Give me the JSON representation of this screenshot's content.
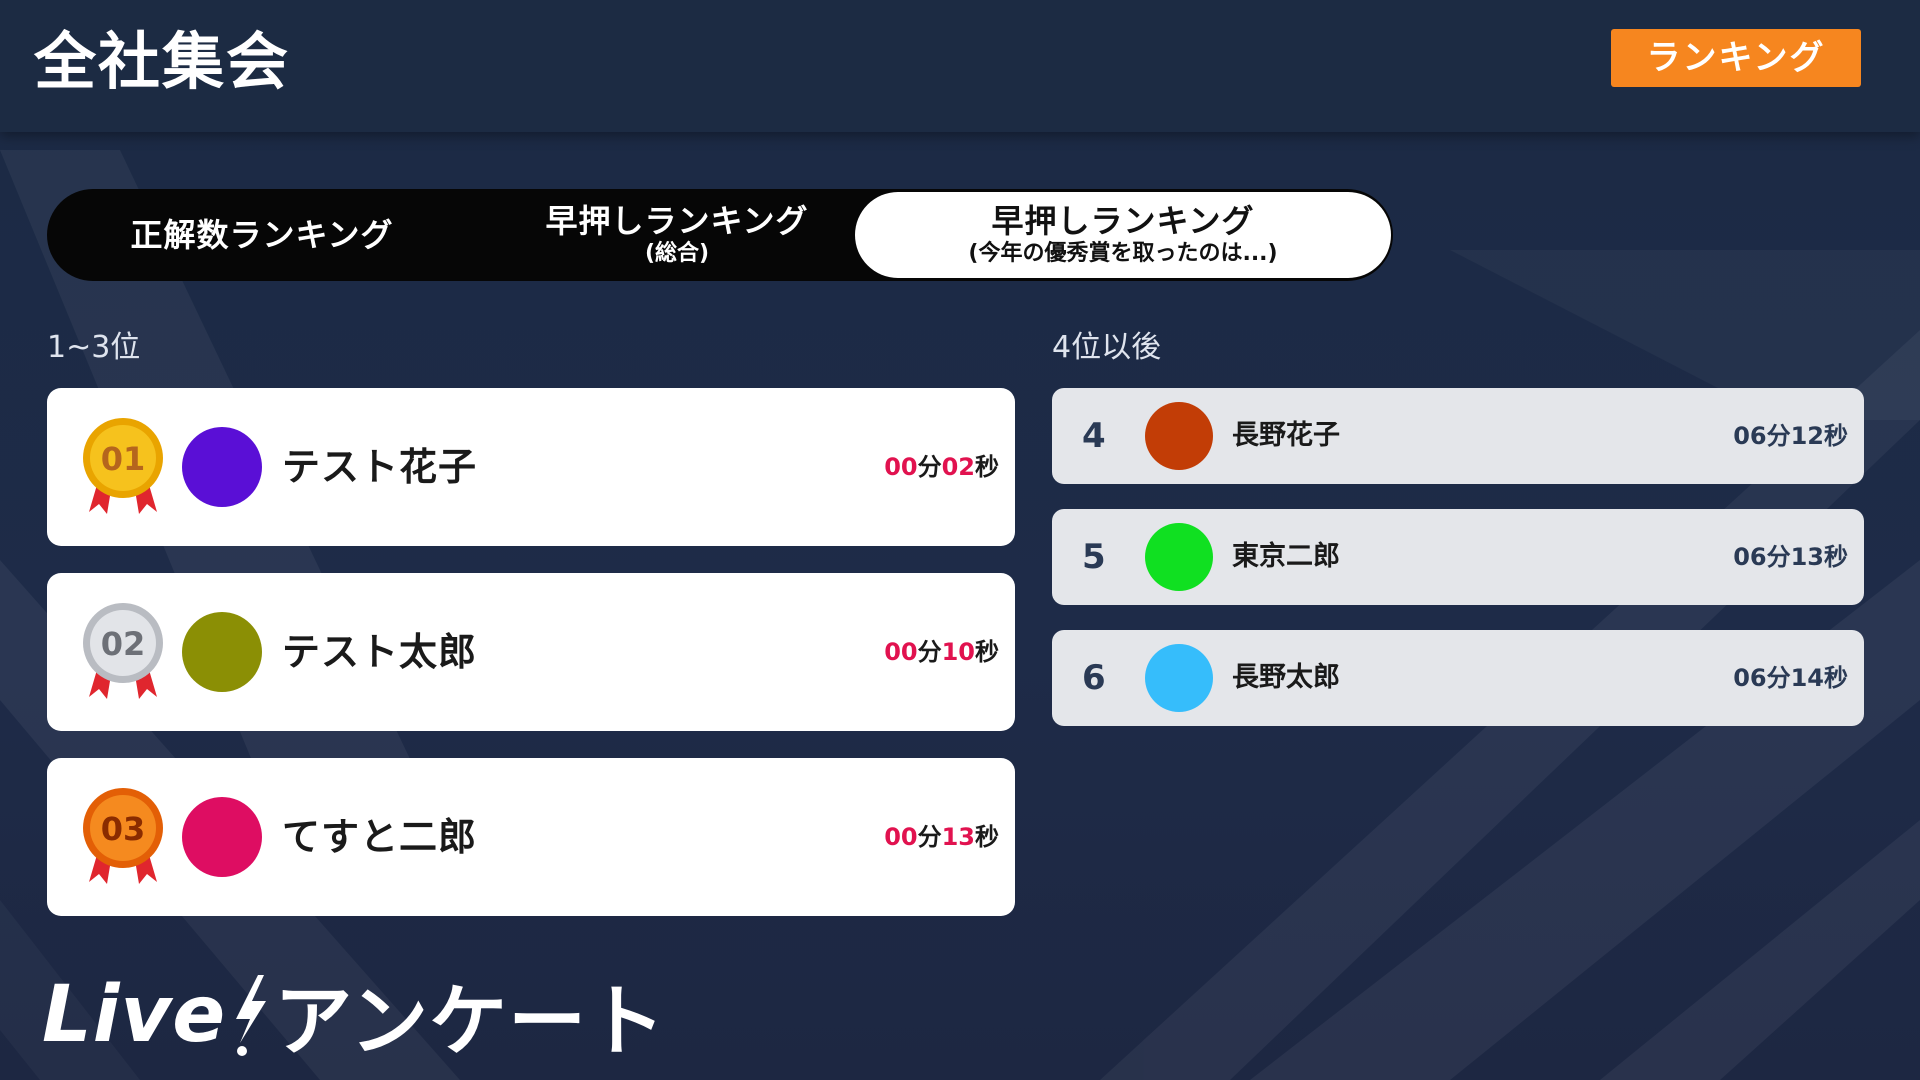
{
  "header": {
    "title": "全社集会",
    "ranking_button": "ランキング",
    "ranking_color": "#f6861f"
  },
  "tabs": [
    {
      "main": "正解数ランキング",
      "sub": "",
      "active": false
    },
    {
      "main": "早押しランキング",
      "sub": "(総合)",
      "active": false
    },
    {
      "main": "早押しランキング",
      "sub": "(今年の優秀賞を取ったのは...)",
      "active": true
    }
  ],
  "top_section": {
    "label": "1~3位",
    "entries": [
      {
        "rank_badge": "01",
        "medal": "gold-medal-icon",
        "avatar_color": "#5a0fd6",
        "name": "テスト花子",
        "min": "00",
        "min_unit": "分",
        "sec": "02",
        "sec_unit": "秒"
      },
      {
        "rank_badge": "02",
        "medal": "silver-medal-icon",
        "avatar_color": "#8b8f05",
        "name": "テスト太郎",
        "min": "00",
        "min_unit": "分",
        "sec": "10",
        "sec_unit": "秒"
      },
      {
        "rank_badge": "03",
        "medal": "bronze-medal-icon",
        "avatar_color": "#de0d62",
        "name": "てすと二郎",
        "min": "00",
        "min_unit": "分",
        "sec": "13",
        "sec_unit": "秒"
      }
    ]
  },
  "rest_section": {
    "label": "4位以後",
    "entries": [
      {
        "rank": "4",
        "avatar_color": "#c23d06",
        "name": "長野花子",
        "time": "06分12秒"
      },
      {
        "rank": "5",
        "avatar_color": "#10e021",
        "name": "東京二郎",
        "time": "06分13秒"
      },
      {
        "rank": "6",
        "avatar_color": "#36bdfb",
        "name": "長野太郎",
        "time": "06分14秒"
      }
    ]
  },
  "footer": {
    "logo_live": "Live",
    "logo_icon": "lightning-icon",
    "logo_text": "アンケート"
  }
}
